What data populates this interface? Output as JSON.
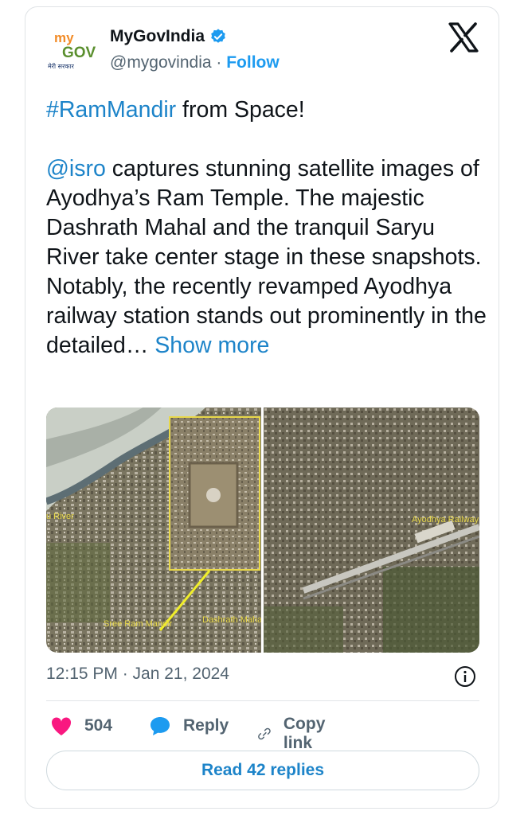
{
  "author": {
    "name": "MyGovIndia",
    "handle": "@mygovindia",
    "separator": "·",
    "follow_label": "Follow",
    "avatar_text_my": "my",
    "avatar_text_gov": "GOV",
    "avatar_subtext": "मेरी सरकार"
  },
  "tweet": {
    "hashtag": "#RamMandir",
    "line1_rest": " from Space!",
    "mention": "@isro",
    "body": " captures stunning satellite images of Ayodhya’s Ram Temple. The majestic Dashrath Mahal and the tranquil Saryu River take center stage in these snapshots. Notably, the recently revamped Ayodhya railway station stands out prominently in the detailed…",
    "show_more": "Show more"
  },
  "media": {
    "left_labels": [
      "u River",
      "Sree Ram Mandir",
      "Dashrath Mahal"
    ],
    "right_labels": [
      "Ayodhya Railway Stn"
    ]
  },
  "meta": {
    "timestamp": "12:15 PM · Jan 21, 2024"
  },
  "actions": {
    "like_count": "504",
    "reply_label": "Reply",
    "copy_link_label": "Copy link"
  },
  "read_replies_label": "Read 42 replies",
  "colors": {
    "accent": "#1d9bf0",
    "link": "#1d84c9",
    "like": "#f91880",
    "muted": "#536471"
  }
}
